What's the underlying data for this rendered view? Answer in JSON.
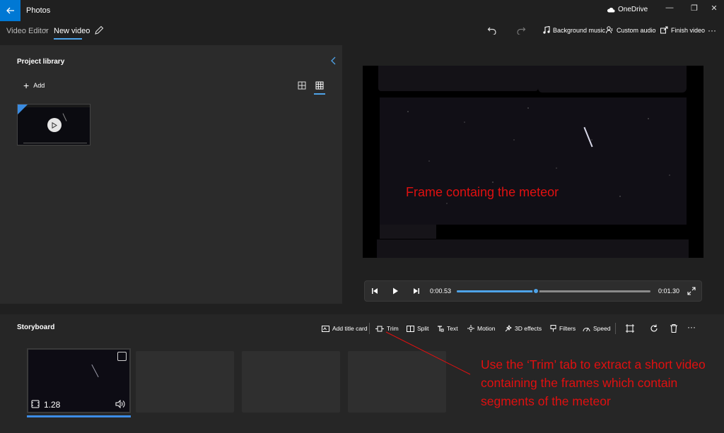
{
  "titlebar": {
    "app_title": "Photos",
    "onedrive_label": "OneDrive",
    "minimize_glyph": "—",
    "maximize_glyph": "❐",
    "close_glyph": "✕"
  },
  "breadcrumb": {
    "parent": "Video Editor",
    "separator": "›",
    "current": "New video"
  },
  "toolbar": {
    "undo_icon": "undo-icon",
    "redo_icon": "redo-icon",
    "background_music": "Background music",
    "custom_audio": "Custom audio",
    "finish_video": "Finish video",
    "more": "···"
  },
  "library": {
    "title": "Project library",
    "add_label": "Add"
  },
  "preview": {
    "annotation": "Frame containg the meteor"
  },
  "playback": {
    "current_time": "0:00.53",
    "total_time": "0:01.30",
    "progress": 0.41
  },
  "storyboard": {
    "title": "Storyboard",
    "tools": {
      "add_title_card": "Add title card",
      "trim": "Trim",
      "split": "Split",
      "text": "Text",
      "motion": "Motion",
      "effects_3d": "3D effects",
      "filters": "Filters",
      "speed": "Speed"
    },
    "more": "···",
    "clip_duration": "1.28",
    "annotation": "Use the ‘Trim’ tab to extract a short video containing the frames which contain segments of the meteor"
  },
  "colors": {
    "accent": "#4ea3e8",
    "back_button": "#0078d4",
    "annotation": "#e01010"
  }
}
